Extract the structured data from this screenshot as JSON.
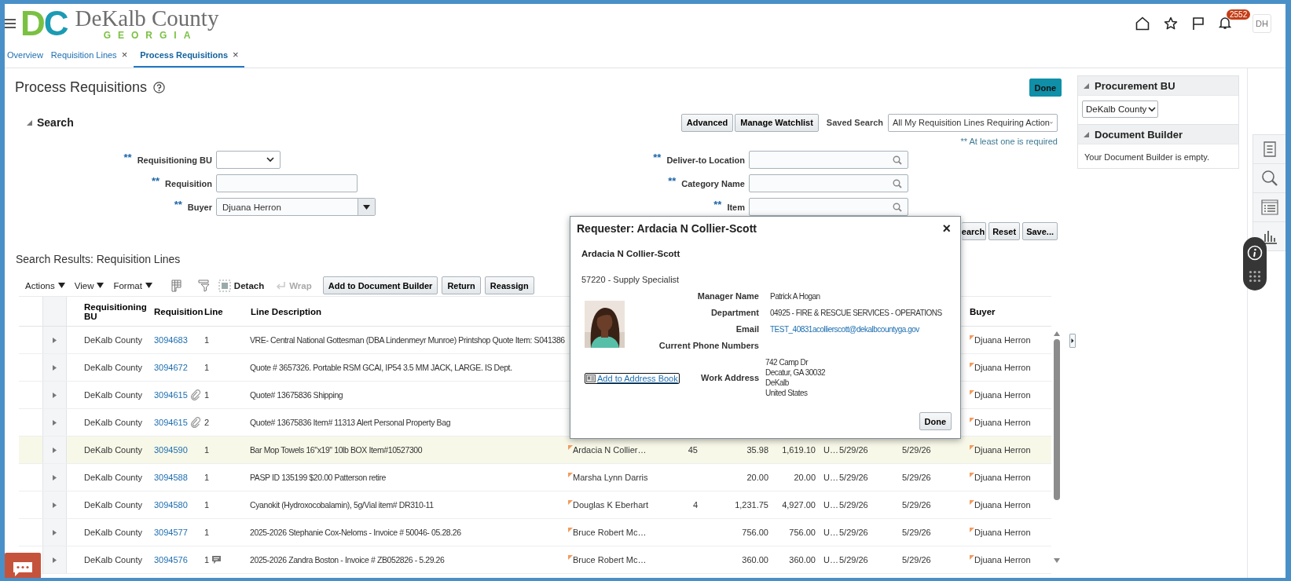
{
  "header": {
    "logo": {
      "monogram": [
        "D",
        "C"
      ],
      "name": "DeKalb County",
      "state": "GEORGIA"
    },
    "notifications": {
      "count": "2552"
    },
    "user": {
      "initials": "DH"
    }
  },
  "tabs": [
    {
      "label": "Overview",
      "selected": false
    },
    {
      "label": "Requisition Lines",
      "close": "×",
      "selected": false
    },
    {
      "label": "Process Requisitions",
      "close": "×",
      "selected": true
    }
  ],
  "page": {
    "title": "Process Requisitions",
    "done": "Done"
  },
  "search": {
    "title": "Search",
    "expanded": true,
    "buttons": [
      "Advanced",
      "Manage Watchlist"
    ],
    "saved_search": {
      "label": "Saved Search",
      "value": "All My Requisition Lines Requiring Action"
    },
    "required_note": "** At least one is required",
    "fields": [
      {
        "mark": "**",
        "label": "Requisitioning BU",
        "kind": "select"
      },
      {
        "mark": "**",
        "label": "Deliver-to Location",
        "kind": "lookup"
      },
      {
        "mark": "**",
        "label": "Requisition",
        "kind": "text"
      },
      {
        "mark": "**",
        "label": "Category Name",
        "kind": "lookup"
      },
      {
        "mark": "**",
        "label": "Buyer",
        "kind": "combo",
        "value": "Djuana Herron"
      },
      {
        "mark": "**",
        "label": "Item",
        "kind": "lookup"
      }
    ],
    "actions": [
      "earch",
      "Reset",
      "Save..."
    ]
  },
  "results": {
    "title": "Search Results: Requisition Lines",
    "menus": [
      "Actions",
      "View",
      "Format"
    ],
    "tools": [
      {
        "label": "Detach",
        "disabled": false
      },
      {
        "label": "Wrap",
        "disabled": true
      }
    ],
    "buttons": [
      "Add to Document Builder",
      "Return",
      "Reassign"
    ],
    "table": {
      "columns": [
        {
          "label": "Requisitioning BU"
        },
        {
          "label": "Requisition"
        },
        {
          "label": "Line"
        },
        {
          "label": "Line Description"
        },
        {
          "label": "Buyer"
        }
      ],
      "rows": [
        {
          "selected": false,
          "expanded": false,
          "bu": "DeKalb County",
          "requisition": "3094683",
          "attachment": false,
          "line": "1",
          "note": false,
          "description": "VRE- Central National Gottesman (DBA Lindenmeyr Munroe) Printshop Quote Item: S041386",
          "buyer": "Djuana Herron"
        },
        {
          "selected": false,
          "expanded": false,
          "bu": "DeKalb County",
          "requisition": "3094672",
          "attachment": false,
          "line": "1",
          "note": false,
          "description": "Quote # 3657326. Portable RSM GCAI, IP54 3.5 MM JACK, LARGE. IS Dept.",
          "buyer": "Djuana Herron"
        },
        {
          "selected": false,
          "expanded": false,
          "bu": "DeKalb County",
          "requisition": "3094615",
          "attachment": true,
          "line": "1",
          "note": false,
          "description": "Quote# 13675836 Shipping",
          "buyer": "Djuana Herron"
        },
        {
          "selected": false,
          "expanded": false,
          "bu": "DeKalb County",
          "requisition": "3094615",
          "attachment": true,
          "line": "2",
          "note": false,
          "description": "Quote# 13675836 Item# 11313 Alert Personal Property Bag",
          "buyer": "Djuana Herron"
        },
        {
          "selected": true,
          "expanded": false,
          "bu": "DeKalb County",
          "requisition": "3094590",
          "attachment": false,
          "line": "1",
          "note": false,
          "description": "Bar Mop Towels 16\"x19\" 10lb BOX Item#10527300",
          "requester": "Ardacia N Collier…",
          "column_8": "45",
          "column_9": "35.98",
          "column_10": "1,619.10",
          "column_11": "U…",
          "column_12": "5/29/26",
          "column_13": "5/29/26",
          "buyer": "Djuana Herron"
        },
        {
          "selected": false,
          "expanded": false,
          "bu": "DeKalb County",
          "requisition": "3094588",
          "attachment": false,
          "line": "1",
          "note": false,
          "description": "PASP ID 135199 $20.00 Patterson retire",
          "requester": "Marsha Lynn Darris",
          "column_9": "20.00",
          "column_10": "20.00",
          "column_11": "U…",
          "column_12": "5/29/26",
          "column_13": "5/29/26",
          "buyer": "Djuana Herron"
        },
        {
          "selected": false,
          "expanded": false,
          "bu": "DeKalb County",
          "requisition": "3094580",
          "attachment": false,
          "line": "1",
          "note": false,
          "description": "Cyanokit (Hydroxocobalamin), 5g/Vial item# DR310-11",
          "requester": "Douglas K Eberhart",
          "column_8": "4",
          "column_9": "1,231.75",
          "column_10": "4,927.00",
          "column_11": "U…",
          "column_12": "5/29/26",
          "column_13": "5/29/26",
          "buyer": "Djuana Herron"
        },
        {
          "selected": false,
          "expanded": false,
          "bu": "DeKalb County",
          "requisition": "3094577",
          "attachment": false,
          "line": "1",
          "note": false,
          "description": "2025-2026 Stephanie Cox-Neloms - Invoice # 50046- 05.28.26",
          "requester": "Bruce Robert Mc…",
          "column_9": "756.00",
          "column_10": "756.00",
          "column_11": "U…",
          "column_12": "5/29/26",
          "column_13": "5/29/26",
          "buyer": "Djuana Herron"
        },
        {
          "selected": false,
          "expanded": false,
          "bu": "DeKalb County",
          "requisition": "3094576",
          "attachment": false,
          "line": "1",
          "note": true,
          "description": "2025-2026 Zandra Boston - Invoice # ZB052826 - 5.29.26",
          "requester": "Bruce Robert Mc…",
          "column_9": "360.00",
          "column_10": "360.00",
          "column_11": "U…",
          "column_12": "5/29/26",
          "column_13": "5/29/26",
          "buyer": "Djuana Herron"
        }
      ]
    }
  },
  "side": {
    "panels": [
      {
        "title": "Procurement BU",
        "expanded": true,
        "kind": "select",
        "value": "DeKalb County"
      },
      {
        "title": "Document Builder",
        "expanded": true,
        "kind": "text",
        "text": "Your Document Builder is empty."
      }
    ]
  },
  "popup": {
    "title": "Requester: Ardacia N Collier-Scott",
    "close": "×",
    "name": "Ardacia N Collier-Scott",
    "position": "57220 - Supply Specialist",
    "link": "Add to Address Book",
    "details": [
      {
        "kind": "text",
        "label": "Manager Name",
        "value": "Patrick A Hogan"
      },
      {
        "kind": "text",
        "label": "Department",
        "value": "04925 - FIRE & RESCUE SERVICES - OPERATIONS"
      },
      {
        "kind": "link",
        "label": "Email",
        "value": "TEST_40831acollierscott@dekalbcountyga.gov"
      },
      {
        "kind": "empty",
        "label": "Current Phone Numbers"
      },
      {
        "kind": "address",
        "label": "Work Address",
        "lines": [
          "742 Camp Dr",
          "Decatur, GA 30032",
          "DeKalb",
          "United States"
        ]
      }
    ],
    "done": "Done"
  }
}
